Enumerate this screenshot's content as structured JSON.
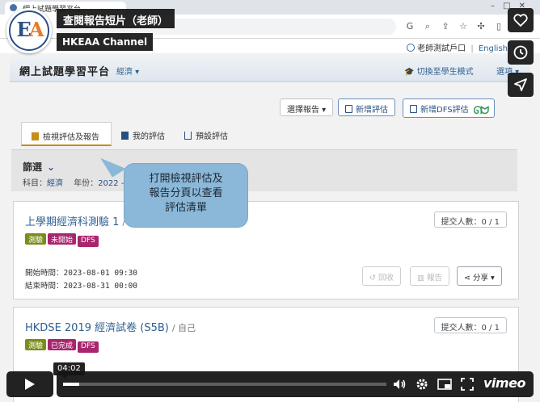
{
  "video": {
    "title": "查閱報告短片（老師）",
    "channel": "HKEAA Channel",
    "time": "04:02",
    "progress": 0.05,
    "brand": "vimeo",
    "side_buttons": [
      "heart-icon",
      "clock-icon",
      "send-icon"
    ]
  },
  "browser": {
    "tab_title": "網上試題學習平台"
  },
  "user_bar": {
    "user": "老師測試戶口",
    "separator": "|",
    "language": "English"
  },
  "nav": {
    "brand": "網上試題學習平台",
    "subject": "經濟 ▾",
    "switch_mode": "切換至學生模式",
    "options": "選項 ▾"
  },
  "actions": {
    "select_report": "選擇報告 ▾",
    "add_assessment": "新增評估",
    "add_dfs": "新增DFS評估"
  },
  "tabs": [
    {
      "label": "檢視評估及報告"
    },
    {
      "label": "我的評估"
    },
    {
      "label": "預設評估"
    }
  ],
  "filter": {
    "title": "篩選",
    "subject_key": "科目：",
    "subject_val": "經濟",
    "year_key": "年份：",
    "year_val": "2022 - 20"
  },
  "tooltip": {
    "line1": "打開檢視評估及",
    "line2": "報告分頁以查看",
    "line3": "評估清單"
  },
  "cards": [
    {
      "title": "上學期經濟科測驗 1",
      "owner": "/ 自己",
      "submitted": "提交人數：0 / 1",
      "tags": [
        {
          "label": "測驗",
          "color": "#7a8d1a"
        },
        {
          "label": "未開始",
          "color": "#a8266e"
        },
        {
          "label": "DFS",
          "color": "#a8266e"
        }
      ],
      "start_key": "開始時間：",
      "start_val": "2023-08-01  09:30",
      "end_key": "結束時間：",
      "end_val": "2023-08-31  00:00",
      "recall": "回收",
      "report": "報告",
      "share": "分享 ▾"
    },
    {
      "title": "HKDSE 2019 經濟試卷 (S5B)",
      "owner": "/ 自己",
      "submitted": "提交人數：0 / 1",
      "tags": [
        {
          "label": "測驗",
          "color": "#7a8d1a"
        },
        {
          "label": "已完成",
          "color": "#a8266e"
        },
        {
          "label": "DFS",
          "color": "#a8266e"
        }
      ]
    }
  ]
}
